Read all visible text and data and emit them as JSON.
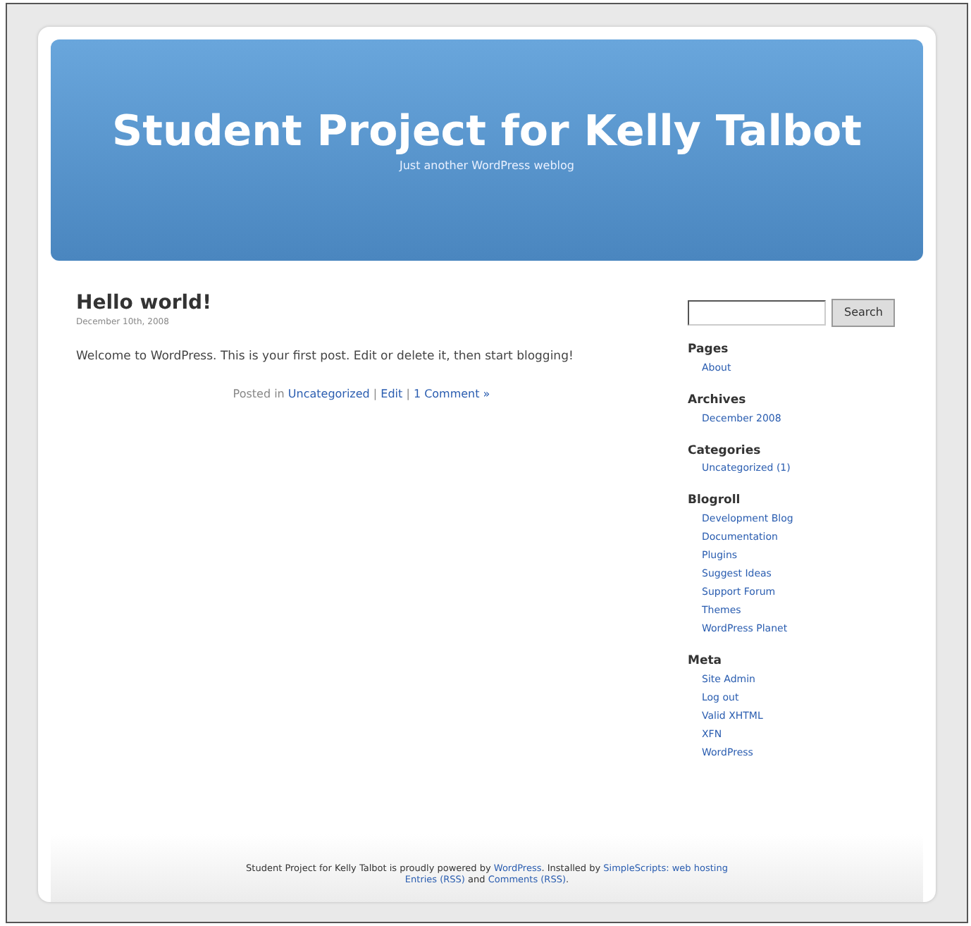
{
  "header": {
    "title": "Student Project for Kelly Talbot",
    "tagline": "Just another WordPress weblog"
  },
  "post": {
    "title": "Hello world!",
    "date": "December 10th, 2008",
    "body": "Welcome to WordPress. This is your first post. Edit or delete it, then start blogging!",
    "meta": [
      {
        "kind": "text",
        "text": "Posted in "
      },
      {
        "kind": "link",
        "text": "Uncategorized"
      },
      {
        "kind": "text",
        "text": " | "
      },
      {
        "kind": "link",
        "text": "Edit"
      },
      {
        "kind": "text",
        "text": " | "
      },
      {
        "kind": "link",
        "text": "1 Comment »"
      }
    ]
  },
  "search": {
    "button": "Search"
  },
  "sidebar": [
    {
      "title": "Pages",
      "items": [
        "About"
      ]
    },
    {
      "title": "Archives",
      "items": [
        "December 2008"
      ]
    },
    {
      "title": "Categories",
      "items": [
        "Uncategorized (1)"
      ]
    },
    {
      "title": "Blogroll",
      "items": [
        "Development Blog",
        "Documentation",
        "Plugins",
        "Suggest Ideas",
        "Support Forum",
        "Themes",
        "WordPress Planet"
      ]
    },
    {
      "title": "Meta",
      "items": [
        "Site Admin",
        "Log out",
        "Valid XHTML",
        "XFN",
        "WordPress"
      ]
    }
  ],
  "footer": [
    [
      {
        "kind": "text",
        "text": "Student Project for Kelly Talbot is proudly powered by "
      },
      {
        "kind": "link",
        "text": "WordPress"
      },
      {
        "kind": "text",
        "text": ". Installed by "
      },
      {
        "kind": "link",
        "text": "SimpleScripts: web hosting"
      }
    ],
    [
      {
        "kind": "link",
        "text": "Entries (RSS)"
      },
      {
        "kind": "text",
        "text": " and "
      },
      {
        "kind": "link",
        "text": "Comments (RSS)"
      },
      {
        "kind": "text",
        "text": "."
      }
    ]
  ]
}
